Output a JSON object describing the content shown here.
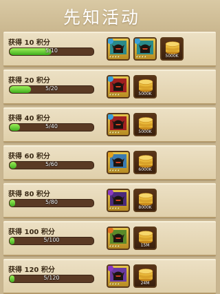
{
  "title": "先知活动",
  "rows": [
    {
      "label": "获得 10 积分",
      "progress": "5/10",
      "fraction": 0.5,
      "rewards": [
        {
          "type": "hero",
          "icon": "dark-knight-hero-icon",
          "badge_color": "#3aa0d8",
          "frame": "#2a8a8a"
        },
        {
          "type": "hero",
          "icon": "dark-knight-hero-icon",
          "badge_color": "#3aa0d8",
          "frame": "#2a8a8a"
        },
        {
          "type": "coin",
          "icon": "gold-coins-icon",
          "amount": "5000K"
        }
      ]
    },
    {
      "label": "获得 20 积分",
      "progress": "5/20",
      "fraction": 0.25,
      "rewards": [
        {
          "type": "hero",
          "icon": "red-knight-hero-icon",
          "badge_color": "#3aa0d8",
          "frame": "#a02020"
        },
        {
          "type": "coin",
          "icon": "gold-coins-icon",
          "amount": "5000K"
        }
      ]
    },
    {
      "label": "获得 40 积分",
      "progress": "5/40",
      "fraction": 0.125,
      "rewards": [
        {
          "type": "hero",
          "icon": "red-knight-hero-icon",
          "badge_color": "#3aa0d8",
          "frame": "#a02020"
        },
        {
          "type": "coin",
          "icon": "gold-coins-icon",
          "amount": "5000K"
        }
      ]
    },
    {
      "label": "获得 60 积分",
      "progress": "5/60",
      "fraction": 0.083,
      "rewards": [
        {
          "type": "hero",
          "icon": "angel-hero-icon",
          "badge_color": "#e0a020",
          "frame": "#3a7ab0"
        },
        {
          "type": "coin",
          "icon": "gold-coins-icon",
          "amount": "6000K"
        }
      ]
    },
    {
      "label": "获得 80 积分",
      "progress": "5/80",
      "fraction": 0.0625,
      "rewards": [
        {
          "type": "hero",
          "icon": "purple-knight-hero-icon",
          "badge_color": "#8a3ac0",
          "frame": "#4a2a7a"
        },
        {
          "type": "coin",
          "icon": "gold-coins-icon",
          "amount": "8000K"
        }
      ]
    },
    {
      "label": "获得 100 积分",
      "progress": "5/100",
      "fraction": 0.05,
      "rewards": [
        {
          "type": "hero",
          "icon": "goblin-hero-icon",
          "badge_color": "#e07020",
          "frame": "#5a8a2a"
        },
        {
          "type": "coin",
          "icon": "gold-coins-icon",
          "amount": "15M"
        }
      ]
    },
    {
      "label": "获得 120 积分",
      "progress": "5/120",
      "fraction": 0.042,
      "rewards": [
        {
          "type": "hero",
          "icon": "purple-dragon-hero-icon",
          "badge_color": "#8a3ac0",
          "frame": "#6a3aa0"
        },
        {
          "type": "coin",
          "icon": "gold-coins-icon",
          "amount": "24M"
        }
      ]
    }
  ]
}
